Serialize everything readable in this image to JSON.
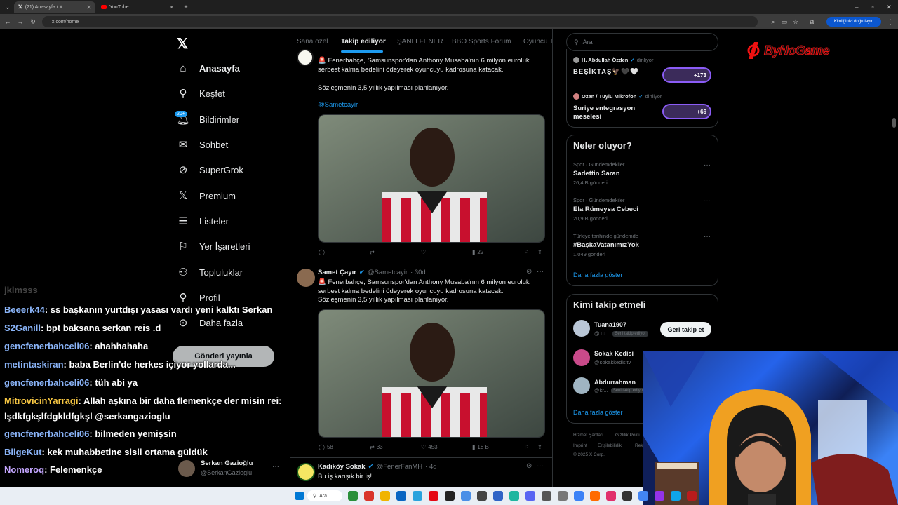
{
  "browser": {
    "tabs": [
      {
        "title": "(21) Anasayfa / X",
        "active": true
      },
      {
        "title": "YouTube",
        "active": false
      }
    ],
    "url": "x.com/home",
    "profile_pill": "Kimliğinizi doğrulayın"
  },
  "left_nav": {
    "items": [
      {
        "label": "Anasayfa",
        "icon": "home-icon"
      },
      {
        "label": "Keşfet",
        "icon": "search-icon"
      },
      {
        "label": "Bildirimler",
        "icon": "bell-icon"
      },
      {
        "label": "Sohbet",
        "icon": "mail-icon"
      },
      {
        "label": "SuperGrok",
        "icon": "grok-icon"
      },
      {
        "label": "Premium",
        "icon": "x-logo-icon"
      },
      {
        "label": "Listeler",
        "icon": "list-icon"
      },
      {
        "label": "Yer İşaretleri",
        "icon": "bookmark-icon"
      },
      {
        "label": "Topluluklar",
        "icon": "communities-icon"
      },
      {
        "label": "Profil",
        "icon": "person-icon"
      },
      {
        "label": "Daha fazla",
        "icon": "more-circle-icon"
      }
    ],
    "notification_badge": "20+",
    "post_button": "Gönderi yayınla",
    "account": {
      "name": "Serkan Gazioğlu",
      "handle": "@SerkanGazioglu"
    }
  },
  "top_tabs": [
    "Sana özel",
    "Takip ediliyor",
    "ŞANLI FENER",
    "BBO Sports Forum",
    "Oyuncu T"
  ],
  "tweets": [
    {
      "text1": "🚨 Fenerbahçe, Samsunspor'dan Anthony Musaba'nın 6 milyon euroluk serbest kalma bedelini ödeyerek oyuncuyu kadrosuna katacak.",
      "text2": "Sözleşmenin 3,5 yıllık yapılması planlanıyor.",
      "mention": "@Sametcayir",
      "replies": "",
      "retweets": "",
      "likes": "",
      "views": "22"
    },
    {
      "name": "Samet Çayır",
      "handle": "@Sametcayir",
      "time": "· 30d",
      "text1": "🚨 Fenerbahçe, Samsunspor'dan Anthony Musaba'nın 6 milyon euroluk serbest kalma bedelini ödeyerek oyuncuyu kadrosuna katacak.",
      "text2": "Sözleşmenin 3,5 yıllık yapılması planlanıyor.",
      "replies": "58",
      "retweets": "33",
      "likes": "453",
      "views": "18 B"
    },
    {
      "name": "Kadıköy Sokak",
      "handle": "@FenerFanMH",
      "time": "· 4d",
      "text1": "Bu iş karışık bir iş!"
    }
  ],
  "right": {
    "search_placeholder": "Ara",
    "spaces": [
      {
        "host": "H. Abdullah Özden",
        "status": "dinliyor",
        "title": "BEŞİKTAŞ🦅🖤🤍",
        "count": "+173"
      },
      {
        "host": "Ozan / Tüylü Mikrofon",
        "status": "dinliyor",
        "title": "Suriye entegrasyon meselesi",
        "count": "+66"
      }
    ],
    "trends_title": "Neler oluyor?",
    "trends": [
      {
        "context": "Spor · Gündemdekiler",
        "name": "Sadettin Saran",
        "posts": "26,4 B gönderi"
      },
      {
        "context": "Spor · Gündemdekiler",
        "name": "Ela Rümeysa Cebeci",
        "posts": "20,9 B gönderi"
      },
      {
        "context": "Türkiye tarihinde gündemde",
        "name": "#BaşkaVatanımızYok",
        "posts": "1.049 gönderi"
      }
    ],
    "show_more": "Daha fazla göster",
    "who_to_follow_title": "Kimi takip etmeli",
    "suggestions": [
      {
        "name": "Tuana1907",
        "handle": "@Tu...",
        "tag": "Seni takip ediyor",
        "button": "Geri takip et"
      },
      {
        "name": "Sokak Kedisi",
        "handle": "@sokakkedisitv",
        "tag": "",
        "button": ""
      },
      {
        "name": "Abdurrahman",
        "handle": "@kr...",
        "tag": "Seni takip ediyor",
        "button": ""
      }
    ],
    "footer": [
      "Hizmet Şartları",
      "Gizlilik Politi",
      "Imprint",
      "Erişilebilirlik",
      "Rek",
      "© 2025 X Corp."
    ]
  },
  "chat": [
    {
      "user": "jklmsss",
      "msg": "",
      "color": "#7c7c7c"
    },
    {
      "user": "Beeerk44",
      "msg": ": ss başkanın yurtdışı yasası vardı yeni kalktı Serkan",
      "color": "#8ab4f8"
    },
    {
      "user": "S2Ganill",
      "msg": ": bpt baksana serkan reis .d",
      "color": "#8ab4f8"
    },
    {
      "user": "gencfenerbahceli06",
      "msg": ": ahahhahaha",
      "color": "#8ab4f8"
    },
    {
      "user": "metintaskiran",
      "msg": ": baba Berlin'de herkes içiyor yollarda...",
      "color": "#8ab4f8"
    },
    {
      "user": "gencfenerbahceli06",
      "msg": ": tüh abi ya",
      "color": "#8ab4f8"
    },
    {
      "user": "MitrovicinYarragi",
      "msg": ": Allah aşkına bir daha flemenkçe der misin rei:",
      "color": "#f5c542"
    },
    {
      "user": "",
      "msg": "lşdkfgkşlfdgkldfgkşl @serkangazioglu",
      "color": "#fff"
    },
    {
      "user": "gencfenerbahceli06",
      "msg": ": bilmeden yemişsin",
      "color": "#8ab4f8"
    },
    {
      "user": "BilgeKut",
      "msg": ": kek muhabbetine sisli ortama güldük",
      "color": "#8ab4f8"
    },
    {
      "user": "Nomeroq",
      "msg": ": Felemenkçe",
      "color": "#c4a6ff"
    }
  ],
  "taskbar": {
    "search": "Ara"
  },
  "logo_text": "ByNoGame"
}
